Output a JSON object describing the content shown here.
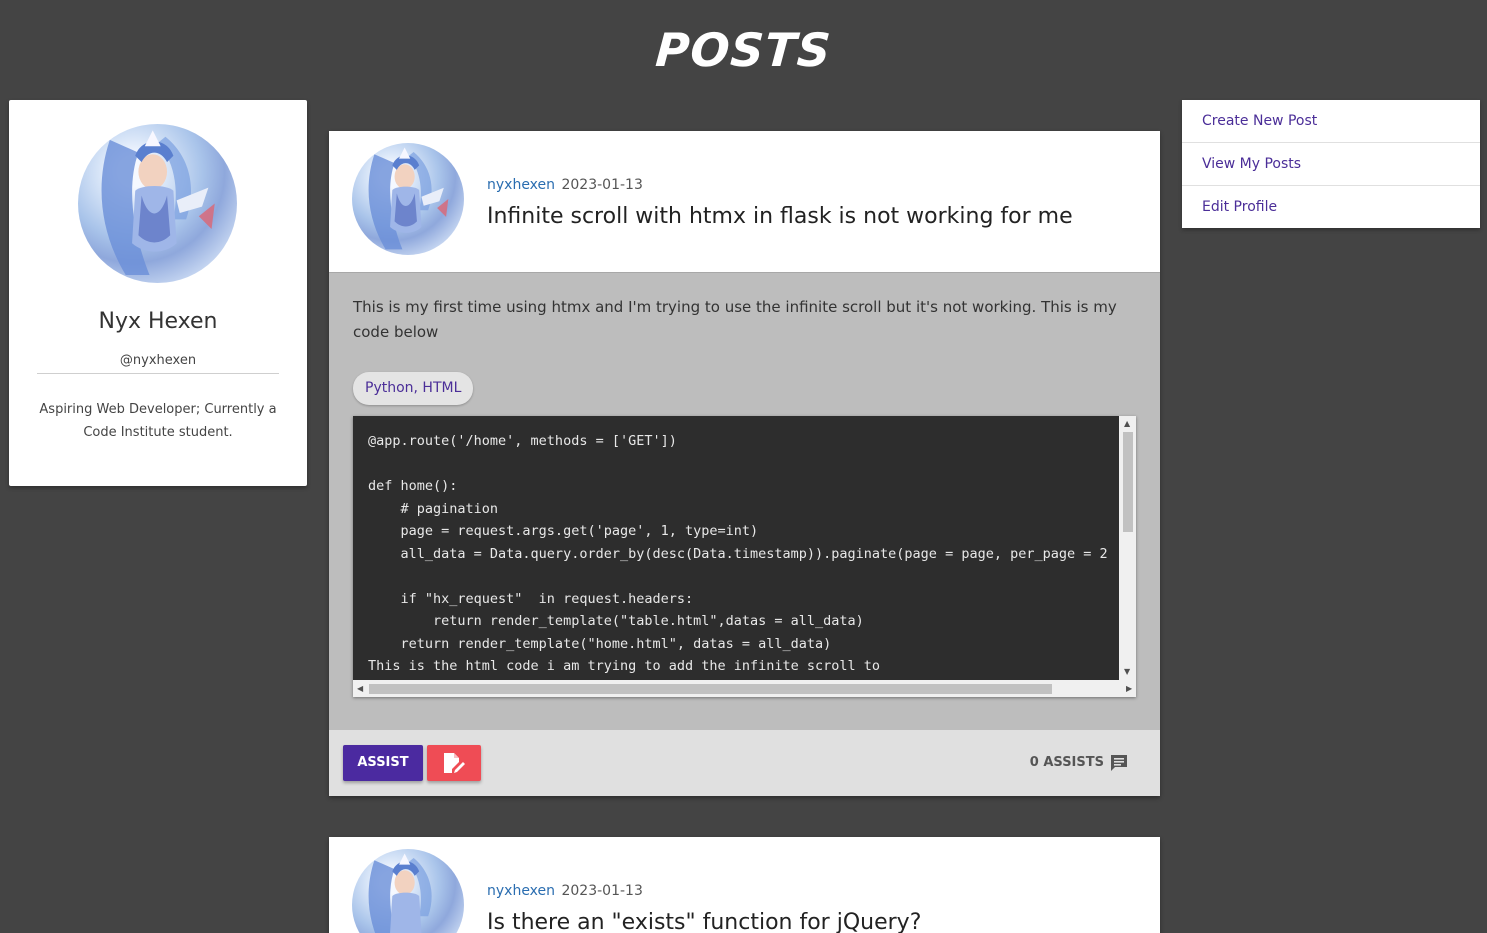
{
  "page": {
    "title": "POSTS"
  },
  "profile": {
    "name": "Nyx Hexen",
    "handle": "@nyxhexen",
    "bio": "Aspiring Web Developer; Currently a Code Institute student.",
    "avatar_icon": "avatar-image"
  },
  "side_menu": {
    "items": [
      {
        "label": "Create New Post"
      },
      {
        "label": "View My Posts"
      },
      {
        "label": "Edit Profile"
      }
    ]
  },
  "posts": [
    {
      "author": "nyxhexen",
      "date": "2023-01-13",
      "title": "Infinite scroll with htmx in flask is not working for me",
      "body": "This is my first time using htmx and I'm trying to use the infinite scroll but it's not working. This is my code below",
      "tags": "Python, HTML",
      "code": "@app.route('/home', methods = ['GET'])\n\ndef home():\n    # pagination\n    page = request.args.get('page', 1, type=int)\n    all_data = Data.query.order_by(desc(Data.timestamp)).paginate(page = page, per_page = 2\n\n    if \"hx_request\"  in request.headers:\n        return render_template(\"table.html\",datas = all_data)\n    return render_template(\"home.html\", datas = all_data)\nThis is the html code i am trying to add the infinite scroll to",
      "assist_label": "ASSIST",
      "assists_count": "0 ASSISTS"
    },
    {
      "author": "nyxhexen",
      "date": "2023-01-13",
      "title": "Is there an \"exists\" function for jQuery?"
    }
  ],
  "colors": {
    "background": "#444444",
    "accent": "#4b2aa0",
    "danger": "#ef4c55",
    "link": "#2a6db0"
  }
}
